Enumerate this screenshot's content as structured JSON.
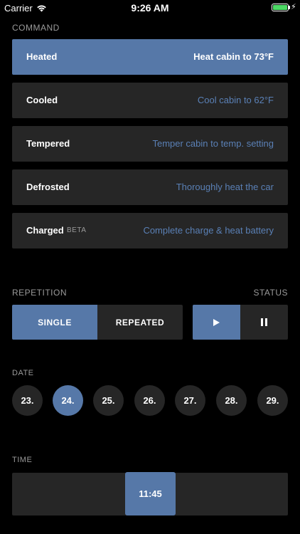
{
  "status_bar": {
    "carrier": "Carrier",
    "time": "9:26 AM",
    "battery_color": "#4cd964"
  },
  "command": {
    "label": "COMMAND",
    "items": [
      {
        "name": "Heated",
        "description": "Heat cabin to 73°F",
        "active": true
      },
      {
        "name": "Cooled",
        "description": "Cool cabin to 62°F",
        "active": false
      },
      {
        "name": "Tempered",
        "description": "Temper cabin to temp. setting",
        "active": false
      },
      {
        "name": "Defrosted",
        "description": "Thoroughly heat the car",
        "active": false
      },
      {
        "name": "Charged",
        "badge": "BETA",
        "description": "Complete charge & heat battery",
        "active": false
      }
    ]
  },
  "repetition": {
    "label": "REPETITION",
    "options": [
      {
        "label": "SINGLE",
        "active": true
      },
      {
        "label": "REPEATED",
        "active": false
      }
    ]
  },
  "status": {
    "label": "STATUS",
    "play_icon": "play-icon",
    "pause_icon": "pause-icon",
    "active": "play"
  },
  "date": {
    "label": "DATE",
    "days": [
      "23.",
      "24.",
      "25.",
      "26.",
      "27.",
      "28.",
      "29."
    ],
    "selected": "24."
  },
  "time": {
    "label": "TIME",
    "value": "11:45"
  },
  "colors": {
    "accent": "#5678a8",
    "surface": "#262626",
    "background": "#000000",
    "link_text": "#5a80b6"
  }
}
